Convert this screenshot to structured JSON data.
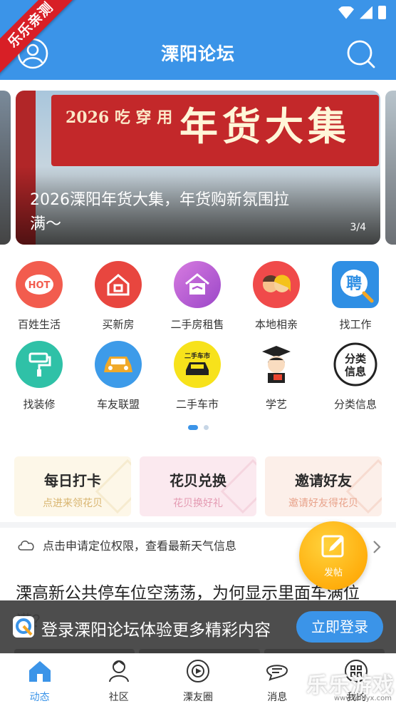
{
  "ribbon": "乐乐亲测",
  "header": {
    "title": "溧阳论坛"
  },
  "banner": {
    "sign_small": "2026 吃 穿 用",
    "sign_big": "年货大集",
    "caption": "2026溧阳年货大集，年货购新氛围拉满〜",
    "pager": "3/4"
  },
  "grid": [
    {
      "label": "百姓生活",
      "icon": "hot-icon",
      "color": "#f25c4e"
    },
    {
      "label": "买新房",
      "icon": "house-icon",
      "color": "#e8463f"
    },
    {
      "label": "二手房租售",
      "icon": "house-handshake-icon",
      "color": "#b35ad2"
    },
    {
      "label": "本地相亲",
      "icon": "couple-icon",
      "color": "#f04a4a"
    },
    {
      "label": "找工作",
      "icon": "recruit-icon",
      "color": "#2f8fe4"
    },
    {
      "label": "找装修",
      "icon": "paint-roller-icon",
      "color": "#2fc1a7"
    },
    {
      "label": "车友联盟",
      "icon": "car-icon",
      "color": "#3d9be9"
    },
    {
      "label": "二手车市",
      "icon": "used-car-icon",
      "color": "#f7e21b"
    },
    {
      "label": "学艺",
      "icon": "graduate-icon",
      "color": "#ffffff"
    },
    {
      "label": "分类信息",
      "icon": "classified-icon",
      "color": "#ffffff"
    }
  ],
  "cards": [
    {
      "title": "每日打卡",
      "subtitle": "点进来领花贝",
      "bg": "#fdf7e8",
      "sub_color": "#d8b46e"
    },
    {
      "title": "花贝兑换",
      "subtitle": "花贝换好礼",
      "bg": "#fbe9ef",
      "sub_color": "#e49ab2"
    },
    {
      "title": "邀请好友",
      "subtitle": "邀请好友得花贝",
      "bg": "#fcefe9",
      "sub_color": "#e8a28a"
    }
  ],
  "weather": {
    "text": "点击申请定位权限，查看最新天气信息"
  },
  "fab": {
    "label": "发帖"
  },
  "post": {
    "title": "溧高新公共停车位空荡荡，为何显示里面车满位满？"
  },
  "login": {
    "text": "登录溧阳论坛体验更多精彩内容",
    "button": "立即登录"
  },
  "tabs": [
    {
      "label": "动态",
      "active": true
    },
    {
      "label": "社区",
      "active": false
    },
    {
      "label": "溧友圈",
      "active": false
    },
    {
      "label": "消息",
      "active": false
    },
    {
      "label": "我的",
      "active": false
    }
  ],
  "watermark": {
    "text": "乐乐游戏",
    "sub": "www.leleyx.com"
  },
  "colors": {
    "primary": "#3b94e8",
    "fab": "#ffb812",
    "ribbon": "#d81f26"
  }
}
